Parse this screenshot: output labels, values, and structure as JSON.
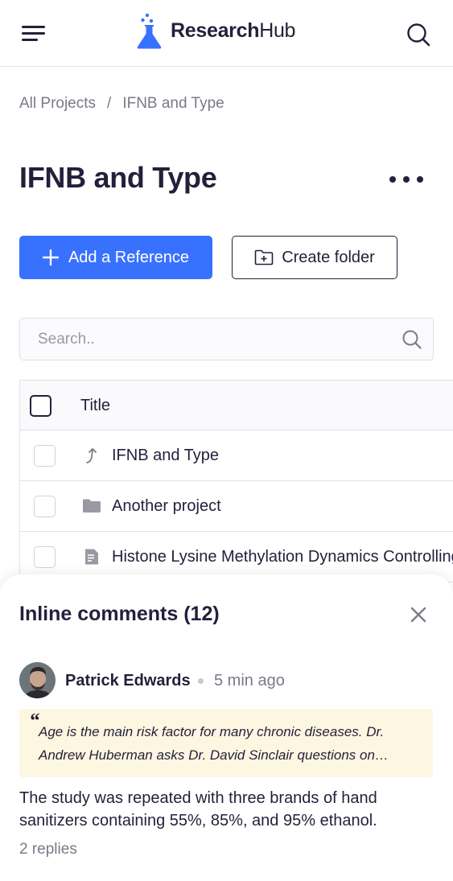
{
  "header": {
    "logo_research": "Research",
    "logo_hub": "Hub",
    "menu_icon": "hamburger-menu-icon",
    "search_icon": "search-icon",
    "brand_color": "#3971ff"
  },
  "breadcrumb": {
    "items": [
      "All Projects",
      "IFNB and Type"
    ],
    "separator": "/"
  },
  "page": {
    "title": "IFNB and Type",
    "more_icon": "more-horizontal-icon"
  },
  "actions": {
    "add_reference": "Add a Reference",
    "create_folder": "Create folder"
  },
  "search": {
    "placeholder": "Search..",
    "value": ""
  },
  "table": {
    "header_title": "Title",
    "rows": [
      {
        "icon": "arrow-up-icon",
        "label": "IFNB and Type"
      },
      {
        "icon": "folder-icon",
        "label": "Another project"
      },
      {
        "icon": "document-icon",
        "label": "Histone Lysine Methylation Dynamics Controlling Gene Expression"
      }
    ]
  },
  "comments_panel": {
    "title": "Inline comments (12)",
    "comment": {
      "author": "Patrick Edwards",
      "time": "5 min ago",
      "quote": "Age is the main risk factor for many chronic diseases. Dr. Andrew Huberman asks Dr. David Sinclair questions on…",
      "body": "The study was repeated with three brands of hand sanitizers containing 55%, 85%, and 95% ethanol.",
      "replies": "2 replies"
    }
  }
}
